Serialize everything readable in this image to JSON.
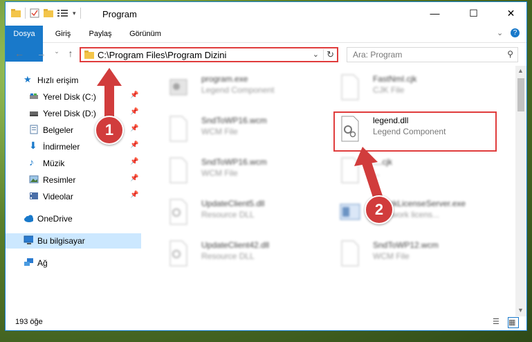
{
  "window": {
    "title": "Program"
  },
  "ribbon": {
    "tabs": [
      "Dosya",
      "Giriş",
      "Paylaş",
      "Görünüm"
    ]
  },
  "address": {
    "path": "C:\\Program Files\\Program Dizini"
  },
  "search": {
    "placeholder": "Ara: Program"
  },
  "sidebar": {
    "items": [
      {
        "label": "Hızlı erişim",
        "icon": "star-icon",
        "pinned": false
      },
      {
        "label": "Yerel Disk (C:)",
        "icon": "drive-icon",
        "pinned": true
      },
      {
        "label": "Yerel Disk (D:)",
        "icon": "drive-icon",
        "pinned": true
      },
      {
        "label": "Belgeler",
        "icon": "documents-icon",
        "pinned": true
      },
      {
        "label": "İndirmeler",
        "icon": "download-icon",
        "pinned": true
      },
      {
        "label": "Müzik",
        "icon": "music-icon",
        "pinned": true
      },
      {
        "label": "Resimler",
        "icon": "pictures-icon",
        "pinned": true
      },
      {
        "label": "Videolar",
        "icon": "videos-icon",
        "pinned": true
      },
      {
        "label": "OneDrive",
        "icon": "cloud-icon",
        "pinned": false
      },
      {
        "label": "Bu bilgisayar",
        "icon": "computer-icon",
        "pinned": false
      },
      {
        "label": "Ağ",
        "icon": "network-icon",
        "pinned": false
      }
    ]
  },
  "files": [
    {
      "name": "program.exe",
      "type": "Legend Component"
    },
    {
      "name": "FastNmI.cjk",
      "type": "CJK File"
    },
    {
      "name": "SndToWP16.wcm",
      "type": "WCM File"
    },
    {
      "name": "legend.dll",
      "type": "Legend Component"
    },
    {
      "name": "SndToWP16.wcm",
      "type": "WCM File"
    },
    {
      "name": "....cjk",
      "type": "..."
    },
    {
      "name": "UpdateClient5.dll",
      "type": "Resource DLL"
    },
    {
      "name": "...workLicenseServer.exe",
      "type": "...network licens..."
    },
    {
      "name": "UpdateClient42.dll",
      "type": "Resource DLL"
    },
    {
      "name": "SndToWP12.wcm",
      "type": "WCM File"
    }
  ],
  "status": {
    "count": "193 öğe"
  },
  "annotations": {
    "step1": "1",
    "step2": "2"
  },
  "colors": {
    "accent": "#1979ca",
    "highlight": "#e03c3c"
  }
}
